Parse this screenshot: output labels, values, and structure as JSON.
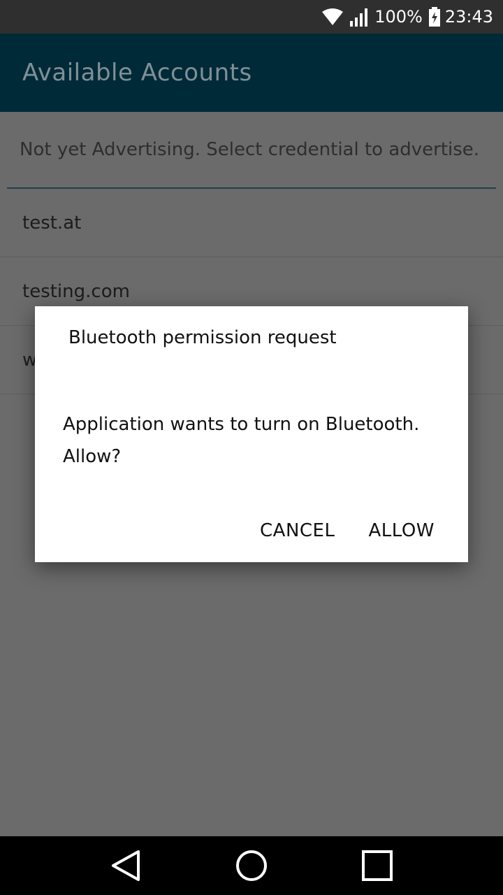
{
  "status_bar": {
    "battery": "100%",
    "time": "23:43",
    "icons": [
      "wifi-icon",
      "signal-icon",
      "battery-charging-icon"
    ]
  },
  "app_bar": {
    "title": "Available Accounts"
  },
  "content": {
    "status_message": "Not yet Advertising. Select credential to advertise.",
    "accounts": [
      "test.at",
      "testing.com",
      "w"
    ]
  },
  "dialog": {
    "title": "Bluetooth permission request",
    "message": "Application wants to turn on Bluetooth. Allow?",
    "cancel_label": "CANCEL",
    "allow_label": "ALLOW"
  },
  "nav_bar": {
    "icons": [
      "back-icon",
      "home-icon",
      "recents-icon"
    ]
  },
  "colors": {
    "app_bar_bg": "#002a38",
    "scrim": "#6b6b6b",
    "dialog_bg": "#ffffff"
  }
}
